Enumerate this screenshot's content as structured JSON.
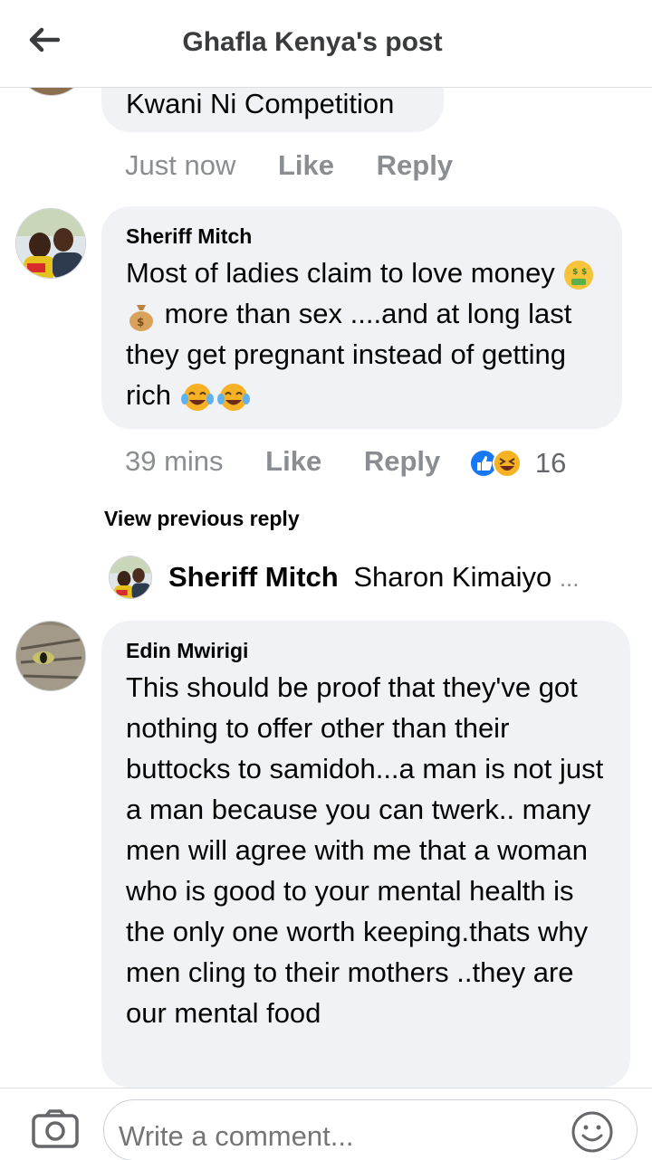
{
  "header": {
    "title": "Ghafla Kenya's post"
  },
  "comments": [
    {
      "text": "Kwani Ni Competition",
      "time": "Just now",
      "like": "Like",
      "reply": "Reply"
    },
    {
      "author": "Sheriff Mitch",
      "text_before": "Most of ladies claim to love money",
      "text_mid": " more than sex ....and at long last they get pregnant instead of getting rich",
      "time": "39 mins",
      "like": "Like",
      "reply": "Reply",
      "reaction_count": "16"
    },
    {
      "author": "Edin Mwirigi",
      "text": "This should be proof that they've got nothing to offer other than their buttocks to samidoh...a man is not just a man because you can twerk.. many men will agree with me that a woman who is good to your mental health is the only one worth keeping.thats why men cling to their mothers ..they are our mental food"
    }
  ],
  "view_previous": "View previous reply",
  "reply_preview": {
    "author": "Sheriff Mitch",
    "text": "Sharon Kimaiyo",
    "ellipsis": "..."
  },
  "composer": {
    "placeholder": "Write a comment..."
  },
  "colors": {
    "bubble": "#f0f2f5",
    "meta": "#8a8d91",
    "like_blue": "#1877f2",
    "haha_yellow": "#f7b125"
  }
}
